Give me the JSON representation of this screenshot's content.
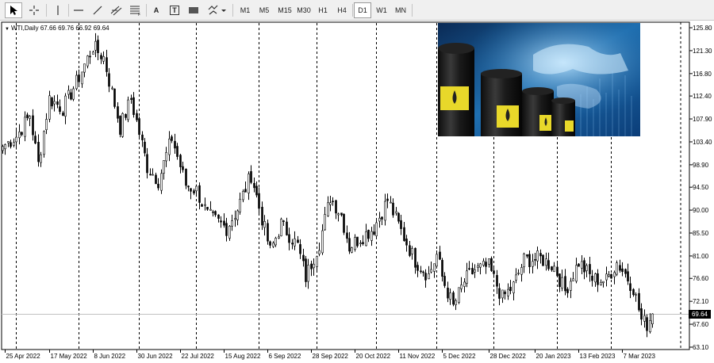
{
  "toolbar": {
    "tools": [
      {
        "name": "cursor-icon"
      },
      {
        "name": "crosshair-icon"
      },
      {
        "name": "vertical-line-icon"
      },
      {
        "name": "horizontal-line-icon"
      },
      {
        "name": "trendline-icon"
      },
      {
        "name": "channel-icon"
      },
      {
        "name": "fibonacci-icon"
      },
      {
        "name": "text-icon",
        "label": "A"
      },
      {
        "name": "text-label-icon",
        "label": "T"
      },
      {
        "name": "rectangle-icon"
      },
      {
        "name": "shapes-icon"
      }
    ],
    "timeframes": [
      "M1",
      "M5",
      "M15",
      "M30",
      "H1",
      "H4",
      "D1",
      "W1",
      "MN"
    ],
    "active_timeframe": "D1"
  },
  "chart_title": "WTI,Daily  67.66 69.76 66.92 69.64",
  "current_price": "69.64",
  "colors": {
    "background": "#ffffff",
    "candle_up": "#ffffff",
    "candle_down": "#000000",
    "price_tag": "#000000"
  },
  "chart_data": {
    "type": "candlestick",
    "symbol": "WTI",
    "timeframe": "Daily",
    "last_ohlc": {
      "open": 67.66,
      "high": 69.76,
      "low": 66.92,
      "close": 69.64
    },
    "ylim": [
      63.1,
      125.8
    ],
    "y_ticks": [
      "125.80",
      "121.30",
      "116.80",
      "112.40",
      "107.90",
      "103.40",
      "98.90",
      "94.50",
      "90.00",
      "85.50",
      "81.00",
      "76.60",
      "72.10",
      "67.60",
      "63.10"
    ],
    "x_ticks": [
      "25 Apr 2022",
      "17 May 2022",
      "8 Jun 2022",
      "30 Jun 2022",
      "22 Jul 2022",
      "15 Aug 2022",
      "6 Sep 2022",
      "28 Sep 2022",
      "20 Oct 2022",
      "11 Nov 2022",
      "5 Dec 2022",
      "28 Dec 2022",
      "20 Jan 2023",
      "13 Feb 2023",
      "7 Mar 2023"
    ],
    "period_separators": [
      "1 May 2022",
      "1 Jun 2022",
      "1 Jul 2022",
      "1 Aug 2022",
      "1 Sep 2022",
      "1 Oct 2022",
      "1 Nov 2022",
      "1 Dec 2022",
      "1 Jan 2023",
      "1 Feb 2023",
      "1 Mar 2023"
    ],
    "grid": false,
    "close_path": [
      {
        "date": "2022-04-22",
        "close": 102.5
      },
      {
        "date": "2022-04-29",
        "close": 104.5
      },
      {
        "date": "2022-05-06",
        "close": 108.7
      },
      {
        "date": "2022-05-11",
        "close": 99.0
      },
      {
        "date": "2022-05-17",
        "close": 111.9
      },
      {
        "date": "2022-05-24",
        "close": 110.0
      },
      {
        "date": "2022-05-31",
        "close": 115.0
      },
      {
        "date": "2022-06-08",
        "close": 122.1
      },
      {
        "date": "2022-06-14",
        "close": 120.0
      },
      {
        "date": "2022-06-22",
        "close": 106.2
      },
      {
        "date": "2022-06-28",
        "close": 111.8
      },
      {
        "date": "2022-07-06",
        "close": 98.5
      },
      {
        "date": "2022-07-12",
        "close": 95.8
      },
      {
        "date": "2022-07-19",
        "close": 104.2
      },
      {
        "date": "2022-07-26",
        "close": 95.0
      },
      {
        "date": "2022-08-01",
        "close": 93.9
      },
      {
        "date": "2022-08-05",
        "close": 89.0
      },
      {
        "date": "2022-08-16",
        "close": 86.5
      },
      {
        "date": "2022-08-22",
        "close": 90.2
      },
      {
        "date": "2022-08-29",
        "close": 97.0
      },
      {
        "date": "2022-09-07",
        "close": 81.9
      },
      {
        "date": "2022-09-13",
        "close": 87.3
      },
      {
        "date": "2022-09-21",
        "close": 83.0
      },
      {
        "date": "2022-09-26",
        "close": 76.8
      },
      {
        "date": "2022-10-03",
        "close": 83.6
      },
      {
        "date": "2022-10-07",
        "close": 92.6
      },
      {
        "date": "2022-10-13",
        "close": 89.1
      },
      {
        "date": "2022-10-18",
        "close": 82.8
      },
      {
        "date": "2022-10-24",
        "close": 84.6
      },
      {
        "date": "2022-10-31",
        "close": 86.5
      },
      {
        "date": "2022-11-07",
        "close": 92.0
      },
      {
        "date": "2022-11-14",
        "close": 85.9
      },
      {
        "date": "2022-11-21",
        "close": 80.1
      },
      {
        "date": "2022-11-28",
        "close": 77.2
      },
      {
        "date": "2022-12-01",
        "close": 81.2
      },
      {
        "date": "2022-12-05",
        "close": 76.9
      },
      {
        "date": "2022-12-09",
        "close": 71.0
      },
      {
        "date": "2022-12-15",
        "close": 76.0
      },
      {
        "date": "2022-12-21",
        "close": 78.3
      },
      {
        "date": "2022-12-28",
        "close": 78.9
      },
      {
        "date": "2023-01-04",
        "close": 72.8
      },
      {
        "date": "2023-01-10",
        "close": 75.1
      },
      {
        "date": "2023-01-16",
        "close": 80.2
      },
      {
        "date": "2023-01-24",
        "close": 80.5
      },
      {
        "date": "2023-01-31",
        "close": 78.9
      },
      {
        "date": "2023-02-06",
        "close": 74.1
      },
      {
        "date": "2023-02-13",
        "close": 79.8
      },
      {
        "date": "2023-02-20",
        "close": 76.5
      },
      {
        "date": "2023-02-27",
        "close": 76.2
      },
      {
        "date": "2023-03-03",
        "close": 79.7
      },
      {
        "date": "2023-03-08",
        "close": 77.5
      },
      {
        "date": "2023-03-13",
        "close": 74.8
      },
      {
        "date": "2023-03-16",
        "close": 68.4
      },
      {
        "date": "2023-03-20",
        "close": 67.6
      },
      {
        "date": "2023-03-22",
        "close": 69.64
      }
    ]
  }
}
